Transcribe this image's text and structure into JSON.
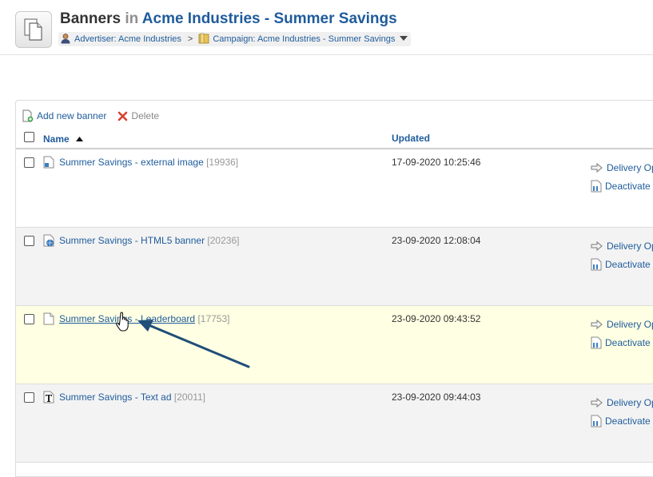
{
  "header": {
    "title_main": "Banners",
    "title_in": "in",
    "title_context": "Acme Industries - Summer Savings",
    "breadcrumb": {
      "advertiser": "Advertiser: Acme Industries",
      "separator": ">",
      "campaign": "Campaign: Acme Industries - Summer Savings"
    }
  },
  "toolbar": {
    "add_label": "Add new banner",
    "delete_label": "Delete"
  },
  "table": {
    "columns": {
      "name": "Name",
      "updated": "Updated"
    },
    "rows": [
      {
        "name": "Summer Savings - external image",
        "id": "[19936]",
        "updated": "17-09-2020 10:25:46",
        "action1": "Delivery Opt",
        "action2": "Deactivate",
        "icon": "external-image-icon"
      },
      {
        "name": "Summer Savings - HTML5 banner",
        "id": "[20236]",
        "updated": "23-09-2020 12:08:04",
        "action1": "Delivery Opt",
        "action2": "Deactivate",
        "icon": "html5-banner-icon"
      },
      {
        "name": "Summer Savings - Leaderboard",
        "id": "[17753]",
        "updated": "23-09-2020 09:43:52",
        "action1": "Delivery Opt",
        "action2": "Deactivate",
        "icon": "blank-file-icon"
      },
      {
        "name": "Summer Savings - Text ad",
        "id": "[20011]",
        "updated": "23-09-2020 09:44:03",
        "action1": "Delivery Opt",
        "action2": "Deactivate",
        "icon": "text-ad-icon"
      }
    ]
  },
  "colors": {
    "link": "#1f5c9c",
    "highlight_row": "#ffffe3",
    "alt_row": "#f3f3f3",
    "annotation_arrow": "#1f4e79"
  }
}
